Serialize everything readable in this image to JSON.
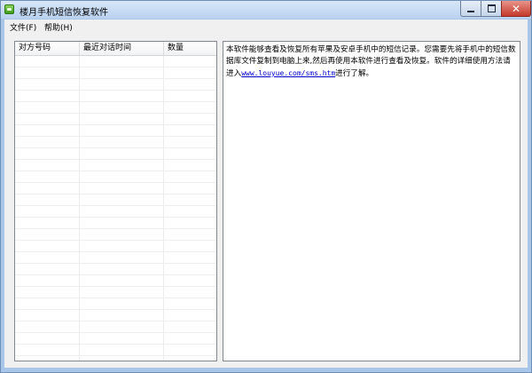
{
  "window": {
    "title": "楼月手机短信恢复软件",
    "icon": "sms-app-icon",
    "colors": {
      "frame": "#a9c6e8",
      "close": "#c4382b"
    }
  },
  "titlebar_buttons": {
    "minimize": "minimize-icon",
    "maximize": "maximize-icon",
    "close": "close-icon",
    "close_glyph": "✕"
  },
  "menubar": {
    "items": [
      {
        "label": "文件(F)"
      },
      {
        "label": "帮助(H)"
      }
    ]
  },
  "message_list": {
    "columns": [
      {
        "label": "对方号码"
      },
      {
        "label": "最近对话时间"
      },
      {
        "label": "数量"
      }
    ],
    "rows": []
  },
  "info_panel": {
    "text_before_link": "本软件能够查看及恢复所有苹果及安卓手机中的短信记录。您需要先将手机中的短信数据库文件复制到电脑上来,然后再使用本软件进行查看及恢复。软件的详细使用方法请进入",
    "link": "www.louyue.com/sms.htm",
    "text_after_link": "进行了解。"
  }
}
